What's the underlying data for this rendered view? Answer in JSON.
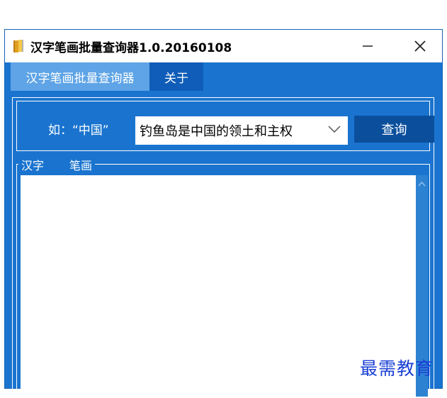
{
  "window": {
    "title": "汉字笔画批量查询器1.0.20160108",
    "minimize_icon": "minimize-icon",
    "close_icon": "close-icon",
    "app_icon": "book-icon"
  },
  "tabs": [
    {
      "label": "汉字笔画批量查询器",
      "active": true
    },
    {
      "label": "关于",
      "active": false
    }
  ],
  "query": {
    "hint": "如：“中国”",
    "input_value": "钓鱼岛是中国的领土和主权",
    "button_label": "查询"
  },
  "results": {
    "columns": [
      "汉字",
      "笔画"
    ],
    "rows": []
  },
  "watermark": "最需教育",
  "colors": {
    "window_bg": "#1a74cf",
    "active_tab": "#5ea4e6",
    "button": "#0b4f9c",
    "watermark": "#1a3fd6"
  }
}
